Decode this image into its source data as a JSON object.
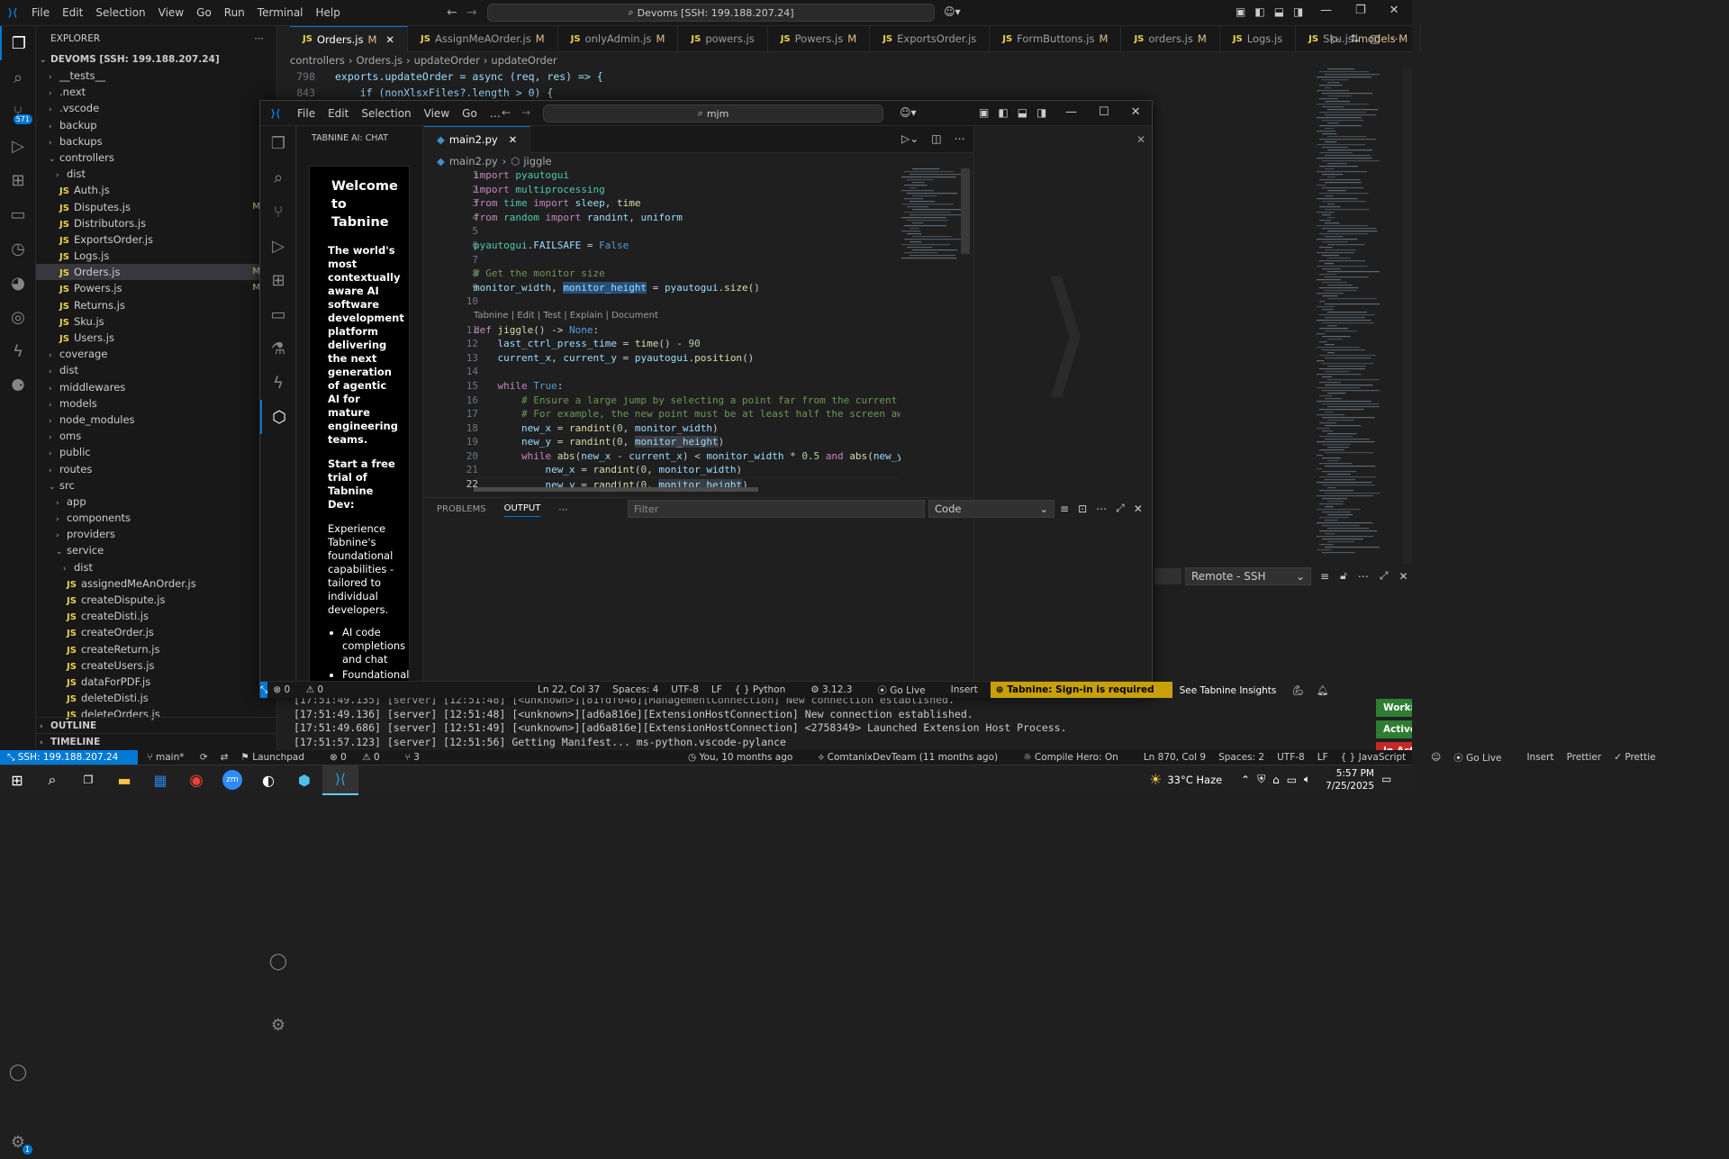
{
  "title_bar": {
    "menus": [
      "File",
      "Edit",
      "Selection",
      "View",
      "Go",
      "Run",
      "Terminal",
      "Help"
    ],
    "search": "Devoms [SSH: 199.188.207.24]"
  },
  "activity": {
    "scm_badge": "571",
    "settings_badge": "1"
  },
  "explorer": {
    "header": "EXPLORER",
    "root": "DEVOMS [SSH: 199.188.207.24]",
    "items": [
      {
        "label": "__tests__",
        "depth": 1,
        "type": "folder",
        "open": false
      },
      {
        "label": ".next",
        "depth": 1,
        "type": "folder",
        "open": false
      },
      {
        "label": ".vscode",
        "depth": 1,
        "type": "folder",
        "open": false
      },
      {
        "label": "backup",
        "depth": 1,
        "type": "folder",
        "open": false
      },
      {
        "label": "backups",
        "depth": 1,
        "type": "folder",
        "open": false
      },
      {
        "label": "controllers",
        "depth": 1,
        "type": "folder",
        "open": true
      },
      {
        "label": "dist",
        "depth": 2,
        "type": "folder",
        "open": false
      },
      {
        "label": "Auth.js",
        "depth": 2,
        "type": "js"
      },
      {
        "label": "Disputes.js",
        "depth": 2,
        "type": "js",
        "mark": "M"
      },
      {
        "label": "Distributors.js",
        "depth": 2,
        "type": "js"
      },
      {
        "label": "ExportsOrder.js",
        "depth": 2,
        "type": "js"
      },
      {
        "label": "Logs.js",
        "depth": 2,
        "type": "js"
      },
      {
        "label": "Orders.js",
        "depth": 2,
        "type": "js",
        "mark": "M",
        "selected": true
      },
      {
        "label": "Powers.js",
        "depth": 2,
        "type": "js",
        "mark": "M"
      },
      {
        "label": "Returns.js",
        "depth": 2,
        "type": "js"
      },
      {
        "label": "Sku.js",
        "depth": 2,
        "type": "js"
      },
      {
        "label": "Users.js",
        "depth": 2,
        "type": "js"
      },
      {
        "label": "coverage",
        "depth": 1,
        "type": "folder",
        "open": false
      },
      {
        "label": "dist",
        "depth": 1,
        "type": "folder",
        "open": false
      },
      {
        "label": "middlewares",
        "depth": 1,
        "type": "folder",
        "open": false
      },
      {
        "label": "models",
        "depth": 1,
        "type": "folder",
        "open": false
      },
      {
        "label": "node_modules",
        "depth": 1,
        "type": "folder",
        "open": false
      },
      {
        "label": "oms",
        "depth": 1,
        "type": "folder",
        "open": false
      },
      {
        "label": "public",
        "depth": 1,
        "type": "folder",
        "open": false
      },
      {
        "label": "routes",
        "depth": 1,
        "type": "folder",
        "open": false
      },
      {
        "label": "src",
        "depth": 1,
        "type": "folder",
        "open": true
      },
      {
        "label": "app",
        "depth": 2,
        "type": "folder",
        "open": false
      },
      {
        "label": "components",
        "depth": 2,
        "type": "folder",
        "open": false
      },
      {
        "label": "providers",
        "depth": 2,
        "type": "folder",
        "open": false
      },
      {
        "label": "service",
        "depth": 2,
        "type": "folder",
        "open": true
      },
      {
        "label": "dist",
        "depth": 3,
        "type": "folder",
        "open": false
      },
      {
        "label": "assignedMeAnOrder.js",
        "depth": 3,
        "type": "js"
      },
      {
        "label": "createDispute.js",
        "depth": 3,
        "type": "js"
      },
      {
        "label": "createDisti.js",
        "depth": 3,
        "type": "js"
      },
      {
        "label": "createOrder.js",
        "depth": 3,
        "type": "js"
      },
      {
        "label": "createReturn.js",
        "depth": 3,
        "type": "js"
      },
      {
        "label": "createUsers.js",
        "depth": 3,
        "type": "js"
      },
      {
        "label": "dataForPDF.js",
        "depth": 3,
        "type": "js"
      },
      {
        "label": "deleteDisti.js",
        "depth": 3,
        "type": "js"
      },
      {
        "label": "deleteOrders.js",
        "depth": 3,
        "type": "js"
      }
    ],
    "outline": "OUTLINE",
    "timeline": "TIMELINE"
  },
  "tabs": [
    {
      "label": "Orders.js",
      "mark": "M",
      "active": true
    },
    {
      "label": "AssignMeAOrder.js",
      "mark": "M"
    },
    {
      "label": "onlyAdmin.js",
      "mark": "M"
    },
    {
      "label": "powers.js",
      "mark": ""
    },
    {
      "label": "Powers.js",
      "mark": "M"
    },
    {
      "label": "ExportsOrder.js",
      "mark": ""
    },
    {
      "label": "FormButtons.js",
      "mark": "M"
    },
    {
      "label": "orders.js",
      "mark": "M"
    },
    {
      "label": "Logs.js",
      "mark": ""
    },
    {
      "label": "Sku.js",
      "mark": "models M"
    }
  ],
  "outer_editor": {
    "breadcrumb": [
      "controllers",
      "Orders.js",
      "updateOrder",
      "updateOrder"
    ],
    "lines": [
      {
        "n": "798",
        "text": "exports.updateOrder = async (req, res) => {"
      },
      {
        "n": "843",
        "text": "    if (nonXlsxFiles?.length > 0) {"
      }
    ]
  },
  "inner_window": {
    "menus": [
      "File",
      "Edit",
      "Selection",
      "View",
      "Go",
      "…"
    ],
    "search": "mjm",
    "tabnine": {
      "header": "TABNINE AI: CHAT",
      "welcome": "Welcome to Tabnine",
      "desc": "The world's most contextually aware AI software development platform delivering the next generation of agentic AI for mature engineering teams.",
      "trial": "Start a free trial of Tabnine Dev:",
      "experience": "Experience Tabnine's foundational capabilities - tailored to individual developers.",
      "bullets": [
        "AI code completions and chat",
        "Foundational"
      ]
    },
    "tab": "main2.py",
    "breadcrumb": [
      "main2.py",
      "jiggle"
    ],
    "codelens": "Tabnine | Edit | Test | Explain | Document",
    "lines": [
      "import pyautogui",
      "import multiprocessing",
      "from time import sleep, time",
      "from random import randint, uniform",
      "",
      "pyautogui.FAILSAFE = False",
      "",
      "# Get the monitor size",
      "monitor_width, monitor_height = pyautogui.size()",
      "",
      "def jiggle() -> None:",
      "    last_ctrl_press_time = time() - 90",
      "    current_x, current_y = pyautogui.position()",
      "",
      "    while True:",
      "        # Ensure a large jump by selecting a point far from the current pos",
      "        # For example, the new point must be at least half the screen away",
      "        new_x = randint(0, monitor_width)",
      "        new_y = randint(0, monitor_height)",
      "        while abs(new_x - current_x) < monitor_width * 0.5 and abs(new_y -",
      "            new_x = randint(0, monitor_width)",
      "            new_y = randint(0, monitor_height)"
    ],
    "panel": {
      "tabs": [
        "PROBLEMS",
        "OUTPUT"
      ],
      "filter": "Filter",
      "select": "Code"
    },
    "status": {
      "errors": "0",
      "warnings": "0",
      "ln": "Ln 22, Col 37",
      "spaces": "Spaces: 4",
      "enc": "UTF-8",
      "eol": "LF",
      "lang": "Python",
      "ver": "3.12.3",
      "golive": "Go Live",
      "insert": "Insert",
      "tabnine": "Tabnine: Sign-in is required",
      "insights": "See Tabnine Insights"
    }
  },
  "outer_panel": {
    "select": "Remote - SSH",
    "lines": [
      "[17:51:49.135] [server] [12:51:48] [<unknown>][81fdf046][ManagementConnection] New connection established.",
      "[17:51:49.136] [server] [12:51:48] [<unknown>][ad6a816e][ExtensionHostConnection] New connection established.",
      "[17:51:49.686] [server] [12:51:49] [<unknown>][ad6a816e][ExtensionHostConnection] <2758349> Launched Extension Host Process.",
      "[17:51:57.123] [server] [12:51:56] Getting Manifest... ms-python.vscode-pylance"
    ],
    "notifs": [
      "Workin",
      "Active",
      "In Acti"
    ]
  },
  "outer_status": {
    "remote": "SSH: 199.188.207.24",
    "branch": "main*",
    "launchpad": "Launchpad",
    "errors": "0",
    "warnings": "0",
    "ports": "3",
    "blame": "You, 10 months ago",
    "author": "ComtanixDevTeam (11 months ago)",
    "compile": "Compile Hero: On",
    "ln": "Ln 870, Col 9",
    "spaces": "Spaces: 2",
    "enc": "UTF-8",
    "eol": "LF",
    "lang": "JavaScript",
    "golive": "Go Live",
    "insert": "Insert",
    "prettier": "Prettier",
    "prettier2": "Prettie"
  },
  "taskbar": {
    "weather": "33°C Haze",
    "time": "5:57 PM",
    "date": "7/25/2025"
  }
}
